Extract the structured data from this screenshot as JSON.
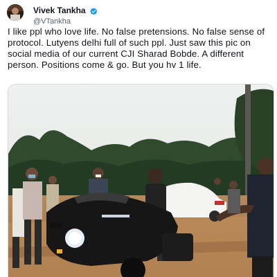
{
  "tweet": {
    "author": {
      "display_name": "Vivek Tankha",
      "handle": "@VTankha",
      "verified": true,
      "avatar_icon": "profile-photo",
      "verified_icon": "verified-badge-icon"
    },
    "text": "I like ppl who love life. No false pretensions. No false sense of protocol. Lutyens delhi full of such ppl. Just saw this pic on social media of our current CJI Sharad Bobde. A different person. Positions come & go. But you hv 1 life.",
    "media": {
      "type": "photo",
      "content": "man seated on a black Harley-Davidson motorcycle surrounded by people outdoors, white car in background"
    }
  },
  "colors": {
    "verified_blue": "#1d9bf0",
    "handle_gray": "#536471",
    "text": "#0f1419"
  }
}
